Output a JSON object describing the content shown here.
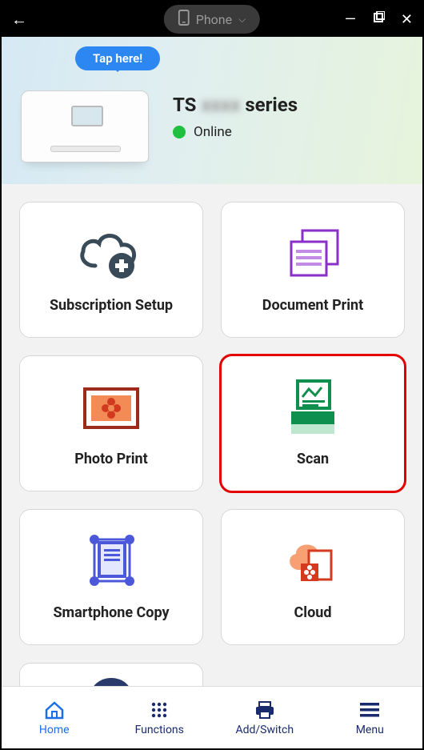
{
  "titlebar": {
    "mode_label": "Phone"
  },
  "hero": {
    "tooltip": "Tap here!",
    "device_prefix": "TS",
    "device_blur": "xxxx",
    "device_suffix": "series",
    "status_text": "Online",
    "status_color": "#1fbf3f"
  },
  "cards": [
    {
      "label": "Subscription Setup",
      "icon": "cloud-plus"
    },
    {
      "label": "Document Print",
      "icon": "document-stack"
    },
    {
      "label": "Photo Print",
      "icon": "photo-flower"
    },
    {
      "label": "Scan",
      "icon": "scanner",
      "highlight": true
    },
    {
      "label": "Smartphone Copy",
      "icon": "crop-doc"
    },
    {
      "label": "Cloud",
      "icon": "cloud-doc"
    }
  ],
  "tabs": [
    {
      "label": "Home",
      "icon": "home",
      "active": true
    },
    {
      "label": "Functions",
      "icon": "grid"
    },
    {
      "label": "Add/Switch",
      "icon": "printer"
    },
    {
      "label": "Menu",
      "icon": "menu"
    }
  ]
}
